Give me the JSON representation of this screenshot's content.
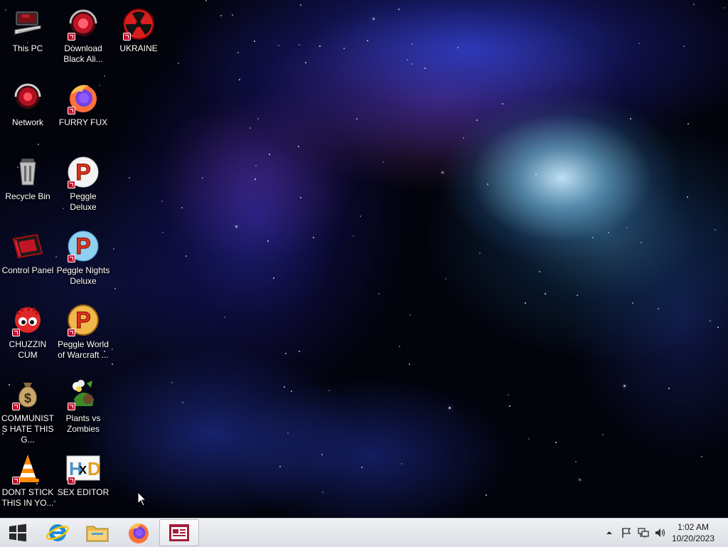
{
  "desktop": {
    "icons": [
      {
        "id": "this-pc",
        "label": "This PC"
      },
      {
        "id": "download-black-ali",
        "label": "Download Black Ali..."
      },
      {
        "id": "ukraine",
        "label": "UKRAINE"
      },
      {
        "id": "network",
        "label": "Network"
      },
      {
        "id": "furry-fux",
        "label": "FURRY FUX"
      },
      {
        "id": "recycle-bin",
        "label": "Recycle Bin"
      },
      {
        "id": "peggle-deluxe",
        "label": "Peggle Deluxe"
      },
      {
        "id": "control-panel",
        "label": "Control Panel"
      },
      {
        "id": "peggle-nights",
        "label": "Peggle Nights Deluxe"
      },
      {
        "id": "chuzzin",
        "label": "CHUZZIN CUM"
      },
      {
        "id": "peggle-world",
        "label": "Peggle World of Warcraft ..."
      },
      {
        "id": "communists",
        "label": "COMMUNISTS HATE THIS G..."
      },
      {
        "id": "pvz",
        "label": "Plants vs Zombies"
      },
      {
        "id": "dont-stick",
        "label": "DONT STICK THIS IN YO..."
      },
      {
        "id": "sex-editor",
        "label": "SEX EDITOR"
      }
    ]
  },
  "taskbar": {
    "pinned": [
      {
        "icon": "windows-logo-icon"
      },
      {
        "icon": "internet-explorer-icon"
      },
      {
        "icon": "file-explorer-icon"
      },
      {
        "icon": "firefox-icon"
      },
      {
        "icon": "active-window-icon"
      }
    ],
    "tray": {
      "icons": [
        "show-hidden-icons-chevron-icon",
        "action-center-flag-icon",
        "network-icon",
        "volume-icon"
      ],
      "time": "1:02 AM",
      "date": "10/20/2023"
    }
  },
  "colors": {
    "taskbar": "#e6e8ec",
    "active_button": "#a31d3a"
  }
}
